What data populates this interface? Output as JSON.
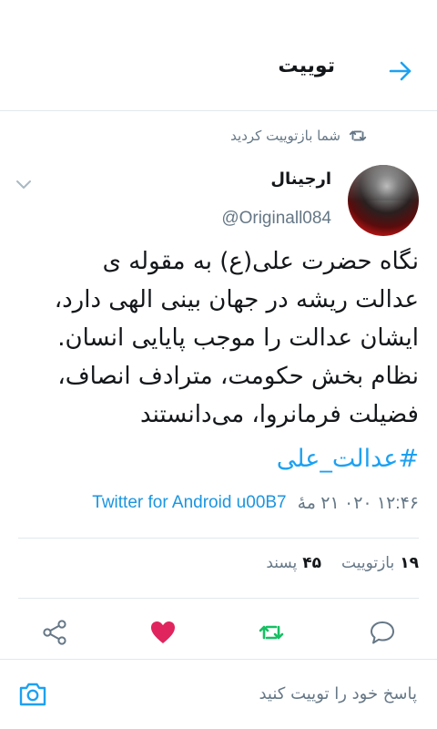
{
  "header": {
    "title": "توییت",
    "back_icon": "arrow-right-icon"
  },
  "retweet_context": {
    "text": "شما بازتوییت کردید",
    "icon": "retweet-icon"
  },
  "author": {
    "name": "ارجینال",
    "handle": "@Originall084"
  },
  "tweet": {
    "lines": [
      "نگاه حضرت علی(ع) به مقوله ی",
      "عدالت ریشه در جهان بینی الهی دارد،",
      "ایشان عدالت را موجب پایایی انسان.",
      "نظام بخش حکومت، مترادف انصاف،",
      "فضیلت فرمانروا، می‌دانستند"
    ],
    "hashtag": "#عدالت_علی"
  },
  "meta": {
    "timestamp": "۱۲:۴۶ ۰۲۰ ۲۱ مهٔ",
    "client": "Twitter for Android u00B7"
  },
  "stats": {
    "retweets_count": "۱۹",
    "retweets_label": "بازتوییت",
    "likes_count": "۴۵",
    "likes_label": "پسند"
  },
  "reply": {
    "placeholder": "پاسخ خود را توییت کنید"
  },
  "colors": {
    "accent": "#1da1f2",
    "like": "#e0245e",
    "retweet": "#17bf63",
    "secondary": "#657786"
  }
}
